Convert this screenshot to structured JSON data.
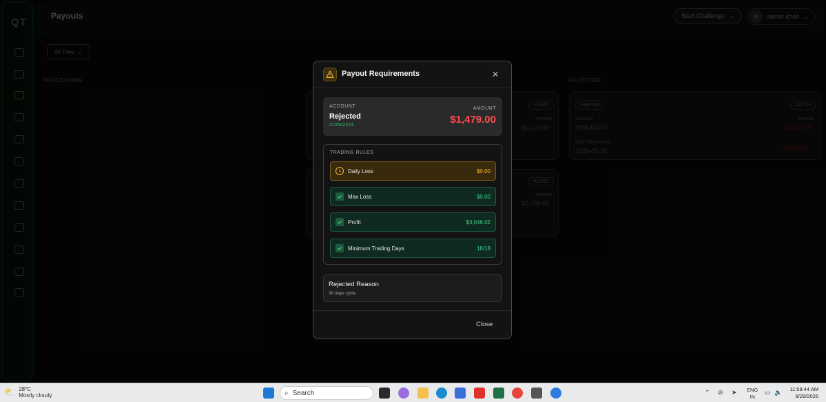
{
  "app": {
    "logo": "QT",
    "page_title": "Payouts",
    "start_challenge": "Start Challenge",
    "user_initials": "sk",
    "user_name": "samar khan",
    "filter_label": "All Time",
    "columns": [
      "PROCESSING",
      "",
      "REJECTED"
    ],
    "bg_cards": {
      "card1": {
        "id": "#12857",
        "amount_label": "Amount",
        "amount": "$1,023.00"
      },
      "card2": {
        "id": "#12851",
        "amount_label": "Amount",
        "amount": "$2,739.00"
      },
      "card3": {
        "badge": "Rejected",
        "id": "#10730",
        "account_label": "Account",
        "account": "#10542474",
        "amount_label": "Amount",
        "amount": "$1,479.00",
        "date_label": "Date Requested",
        "date": "2026-05-28",
        "status": "Rejected"
      }
    }
  },
  "modal": {
    "title": "Payout Requirements",
    "account_label": "ACCOUNT",
    "account_status": "Rejected",
    "account_id": "#10542474",
    "amount_label": "AMOUNT",
    "amount": "$1,479.00",
    "rules_title": "TRADING RULES",
    "rules": [
      {
        "name": "Daily Loss",
        "value": "$0.00",
        "state": "warn",
        "icon": "clock-icon"
      },
      {
        "name": "Max Loss",
        "value": "$0.00",
        "state": "ok",
        "icon": "check-icon"
      },
      {
        "name": "Profit",
        "value": "$3,046.02",
        "state": "ok",
        "icon": "check-icon"
      },
      {
        "name": "Minimum Trading Days",
        "value": "18/18",
        "state": "ok",
        "icon": "check-icon"
      }
    ],
    "reason_title": "Rejected Reason",
    "reason_text": "30 days cycle",
    "close_label": "Close"
  },
  "taskbar": {
    "temperature": "28°C",
    "weather": "Mostly cloudy",
    "search_placeholder": "Search",
    "lang": "ENG",
    "region": "IN",
    "time": "11:58:44 AM",
    "date": "8/28/2026"
  },
  "colors": {
    "accent_green": "#22c55e",
    "danger_red": "#ff4d4d",
    "warn_amber": "#f5b83d"
  }
}
